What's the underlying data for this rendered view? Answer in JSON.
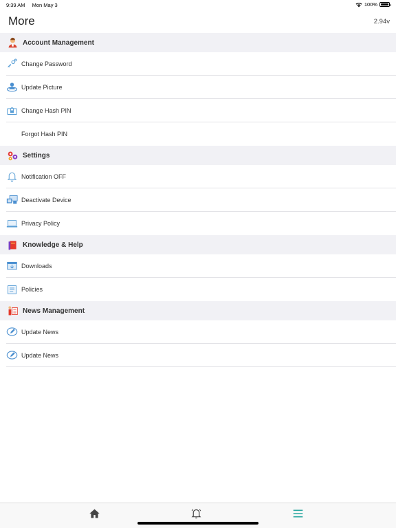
{
  "status_bar": {
    "time": "9:39 AM",
    "date": "Mon May 3",
    "battery": "100%",
    "battery_level": 1.0
  },
  "header": {
    "title": "More",
    "version": "2.94v"
  },
  "sections": [
    {
      "title": "Account Management",
      "icon": "person-icon",
      "items": [
        {
          "label": "Change Password",
          "icon": "key-icon"
        },
        {
          "label": "Update Picture",
          "icon": "user-badge-icon"
        },
        {
          "label": "Change Hash PIN",
          "icon": "lock-screen-icon"
        },
        {
          "label": "Forgot Hash PIN",
          "icon": ""
        }
      ]
    },
    {
      "title": "Settings",
      "icon": "gears-icon",
      "items": [
        {
          "label": "Notification OFF",
          "icon": "bell-icon"
        },
        {
          "label": "Deactivate Device",
          "icon": "devices-icon"
        },
        {
          "label": "Privacy Policy",
          "icon": "laptop-icon"
        }
      ]
    },
    {
      "title": "Knowledge & Help",
      "icon": "book-icon",
      "items": [
        {
          "label": "Downloads",
          "icon": "download-box-icon"
        },
        {
          "label": "Policies",
          "icon": "document-icon"
        }
      ]
    },
    {
      "title": "News Management",
      "icon": "presenter-icon",
      "items": [
        {
          "label": "Update News",
          "icon": "edit-news-icon"
        },
        {
          "label": "Update News",
          "icon": "edit-news-icon"
        }
      ]
    }
  ],
  "tab_bar": {
    "items": [
      "home-icon",
      "bell-icon",
      "menu-icon"
    ],
    "active": "menu-icon",
    "active_color": "#2aa7a0"
  }
}
